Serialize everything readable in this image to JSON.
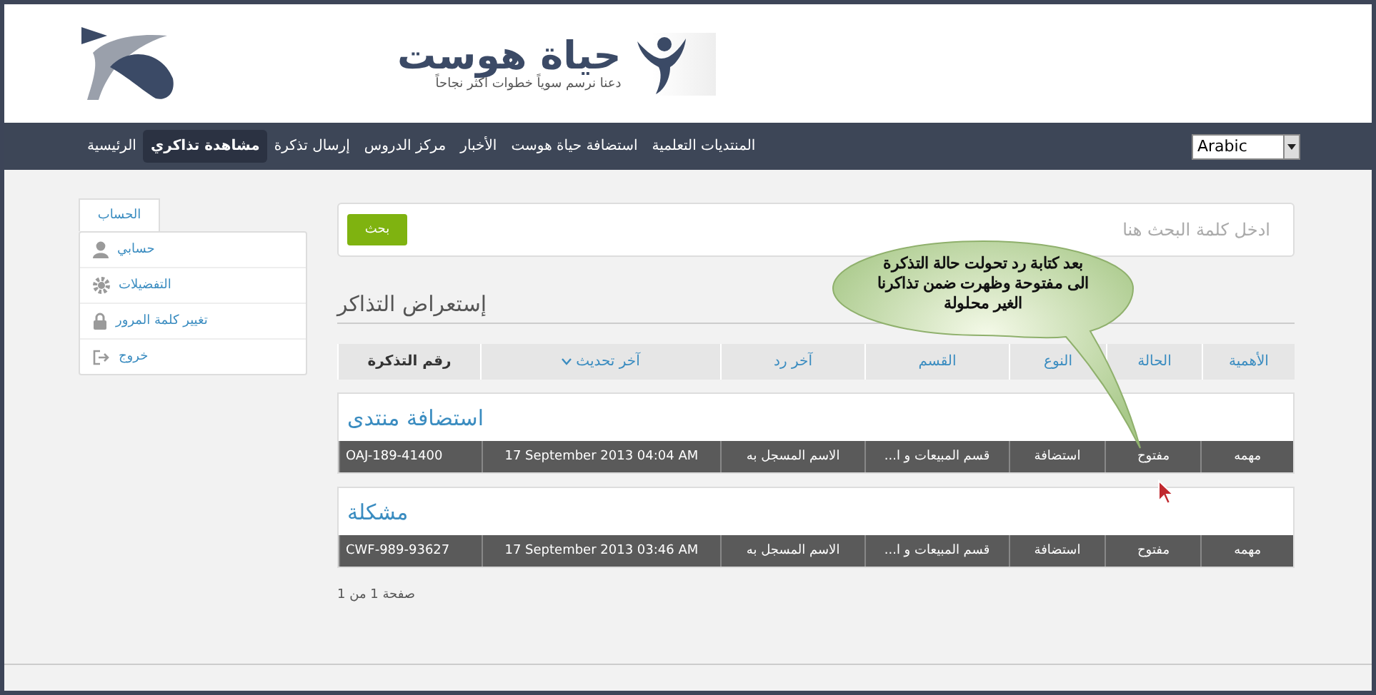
{
  "logo": {
    "name": "حياة هوست",
    "tagline": "دعنا نرسم سوياً خطوات اكثر نجاحاً"
  },
  "nav": [
    {
      "label": "المنتديات التعلمية",
      "selected": false
    },
    {
      "label": "استضافة حياة هوست",
      "selected": false
    },
    {
      "label": "الأخبار",
      "selected": false
    },
    {
      "label": "مركز الدروس",
      "selected": false
    },
    {
      "label": "إرسال تذكرة",
      "selected": false
    },
    {
      "label": "مشاهدة تذاكري",
      "selected": true
    },
    {
      "label": "الرئيسية",
      "selected": false
    }
  ],
  "language_select": {
    "value": "Arabic"
  },
  "sidebar": {
    "tab": "الحساب",
    "items": [
      {
        "label": "حسابي",
        "kind": "user"
      },
      {
        "label": "التفضيلات",
        "kind": "gear"
      },
      {
        "label": "تغيير كلمة المرور",
        "kind": "lock"
      },
      {
        "label": "خروج",
        "kind": "logout"
      }
    ]
  },
  "search": {
    "placeholder": "ادخل كلمة البحث هنا",
    "button": "بحث"
  },
  "heading": "إستعراض التذاكر",
  "callout": [
    "بعد كتابة رد تحولت حالة التذكرة",
    "الى مفتوحة وظهرت ضمن تذاكرنا",
    "الغير محلولة"
  ],
  "table": {
    "columns": [
      {
        "label": "الأهمية",
        "kind": "link"
      },
      {
        "label": "الحالة",
        "kind": "link"
      },
      {
        "label": "النوع",
        "kind": "link"
      },
      {
        "label": "القسم",
        "kind": "link"
      },
      {
        "label": "آخر رد",
        "kind": "link"
      },
      {
        "label": "آخر تحديث",
        "kind": "sorted"
      },
      {
        "label": "رقم التذكرة",
        "kind": "plain"
      }
    ],
    "tickets": [
      {
        "title": "استضافة منتدى",
        "cells": [
          "مهمه",
          "مفتوح",
          "استضافة",
          "...قسم المبيعات و ا",
          "الاسم المسجل به",
          "17 September 2013 04:04 AM",
          "OAJ-189-41400"
        ]
      },
      {
        "title": "مشكلة",
        "cells": [
          "مهمه",
          "مفتوح",
          "استضافة",
          "...قسم المبيعات و ا",
          "الاسم المسجل به",
          "17 September 2013 03:46 AM",
          "CWF-989-93627"
        ]
      }
    ]
  },
  "pagination": "صفحة 1 من 1"
}
